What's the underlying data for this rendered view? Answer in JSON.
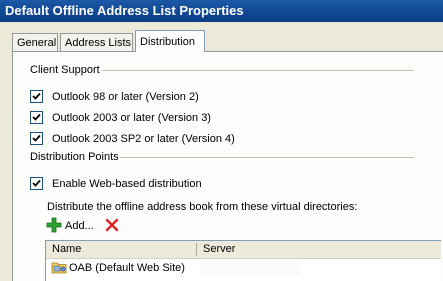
{
  "window": {
    "title": "Default Offline Address List Properties"
  },
  "tabs": [
    {
      "label": "General",
      "active": false
    },
    {
      "label": "Address Lists",
      "active": false
    },
    {
      "label": "Distribution",
      "active": true
    }
  ],
  "client_support": {
    "group_label": "Client Support",
    "options": [
      {
        "label": "Outlook 98 or later (Version 2)",
        "checked": true
      },
      {
        "label": "Outlook 2003 or later (Version 3)",
        "checked": true
      },
      {
        "label": "Outlook 2003 SP2 or later (Version 4)",
        "checked": true
      }
    ]
  },
  "distribution_points": {
    "group_label": "Distribution Points",
    "web_based": {
      "label": "Enable Web-based distribution",
      "checked": true
    },
    "virtual_dirs_label": "Distribute the offline address book from these virtual directories:",
    "add_label": "Add...",
    "columns": [
      "Name",
      "Server"
    ],
    "rows": [
      {
        "name": "OAB (Default Web Site)",
        "server": ""
      }
    ]
  },
  "icons": {
    "add": "plus-icon",
    "remove": "red-x-icon",
    "row": "virtual-directory-icon"
  },
  "colors": {
    "titlebar": "#0a3b86",
    "dialog_bg": "#ece9d8",
    "add_icon": "#2da02d",
    "remove_icon": "#e02020"
  }
}
